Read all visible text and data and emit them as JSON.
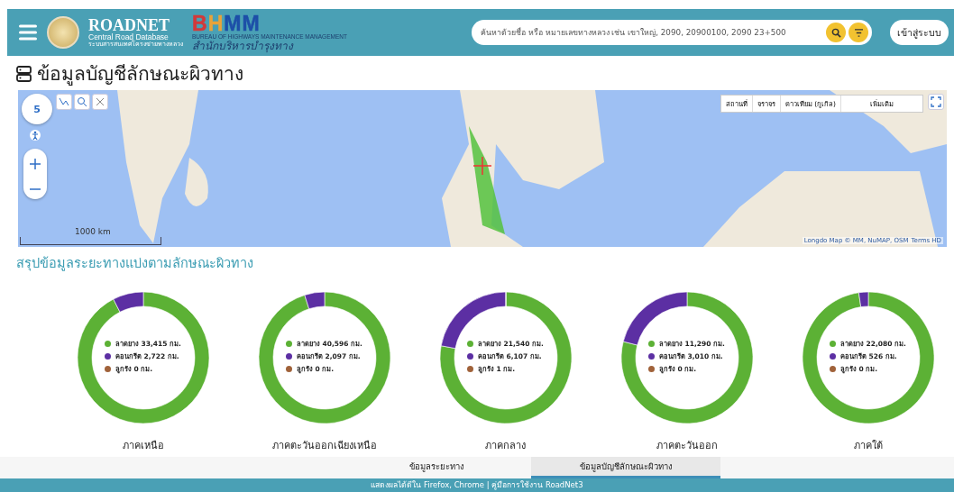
{
  "header": {
    "logo_title": "ROADNET",
    "logo_subtitle": "Central Road Database",
    "logo_caption": "ระบบสารสนเทศโครงข่ายทางหลวง",
    "agency_mark": "BHMM",
    "agency_english": "BUREAU OF HIGHWAYS MAINTENANCE MANAGEMENT",
    "agency_thai": "สำนักบริหารบำรุงทาง",
    "search": {
      "placeholder": "ค้นหาด้วยชื่อ หรือ หมายเลขทางหลวง เช่น เขาใหญ่, 2090, 20900100, 2090 23+500"
    },
    "login_button": "เข้าสู่ระบบ"
  },
  "page_title": "ข้อมูลบัญชีลักษณะผิวทาง",
  "map": {
    "zoom_level": "5",
    "layer_buttons": [
      {
        "label": "สถานที่"
      },
      {
        "label": "จราจร"
      },
      {
        "label": "ดาวเทียม (กูเกิล)"
      }
    ],
    "layer_dropdown": "เพิ่มเติม",
    "scale": "1000 km",
    "attribution": "Longdo Map © MM, NuMAP, OSM",
    "terms": "Terms HD"
  },
  "summary_title": "สรุปข้อมูลระยะทางแบ่งตามลักษณะผิวทาง",
  "regions": [
    {
      "slices": [
        {
          "color": "#5cb135"
        },
        {
          "color": "#5c2fa3"
        },
        {
          "color": "#a0623a"
        }
      ],
      "chart_data": {
        "type": "donut",
        "title": "ภาคเหนือ",
        "legend": "center",
        "categories": [
          "ลาดยาง",
          "คอนกรีต",
          "ลูกรัง"
        ],
        "values": [
          33415,
          2722,
          0
        ],
        "value_labels": [
          "33,415 กม.",
          "2,722 กม.",
          "0 กม."
        ]
      }
    },
    {
      "slices": [
        {
          "color": "#5cb135"
        },
        {
          "color": "#5c2fa3"
        },
        {
          "color": "#a0623a"
        }
      ],
      "chart_data": {
        "type": "donut",
        "title": "ภาคตะวันออกเฉียงเหนือ",
        "legend": "center",
        "categories": [
          "ลาดยาง",
          "คอนกรีต",
          "ลูกรัง"
        ],
        "values": [
          40596,
          2097,
          0
        ],
        "value_labels": [
          "40,596 กม.",
          "2,097 กม.",
          "0 กม."
        ]
      }
    },
    {
      "slices": [
        {
          "color": "#5cb135"
        },
        {
          "color": "#5c2fa3"
        },
        {
          "color": "#a0623a"
        }
      ],
      "chart_data": {
        "type": "donut",
        "title": "ภาคกลาง",
        "legend": "center",
        "categories": [
          "ลาดยาง",
          "คอนกรีต",
          "ลูกรัง"
        ],
        "values": [
          21540,
          6107,
          1
        ],
        "value_labels": [
          "21,540 กม.",
          "6,107 กม.",
          "1 กม."
        ]
      }
    },
    {
      "slices": [
        {
          "color": "#5cb135"
        },
        {
          "color": "#5c2fa3"
        },
        {
          "color": "#a0623a"
        }
      ],
      "chart_data": {
        "type": "donut",
        "title": "ภาคตะวันออก",
        "legend": "center",
        "categories": [
          "ลาดยาง",
          "คอนกรีต",
          "ลูกรัง"
        ],
        "values": [
          11290,
          3010,
          0
        ],
        "value_labels": [
          "11,290 กม.",
          "3,010 กม.",
          "0 กม."
        ]
      }
    },
    {
      "slices": [
        {
          "color": "#5cb135"
        },
        {
          "color": "#5c2fa3"
        },
        {
          "color": "#a0623a"
        }
      ],
      "chart_data": {
        "type": "donut",
        "title": "ภาคใต้",
        "legend": "center",
        "categories": [
          "ลาดยาง",
          "คอนกรีต",
          "ลูกรัง"
        ],
        "values": [
          22080,
          526,
          0
        ],
        "value_labels": [
          "22,080 กม.",
          "526 กม.",
          "0 กม."
        ]
      }
    }
  ],
  "tabs": [
    {
      "label": "ข้อมูลระยะทาง",
      "selected": false
    },
    {
      "label": "ข้อมูลบัญชีลักษณะผิวทาง",
      "selected": true
    }
  ],
  "footer": "แสดงผลได้ดีใน Firefox, Chrome | คู่มือการใช้งาน RoadNet3"
}
